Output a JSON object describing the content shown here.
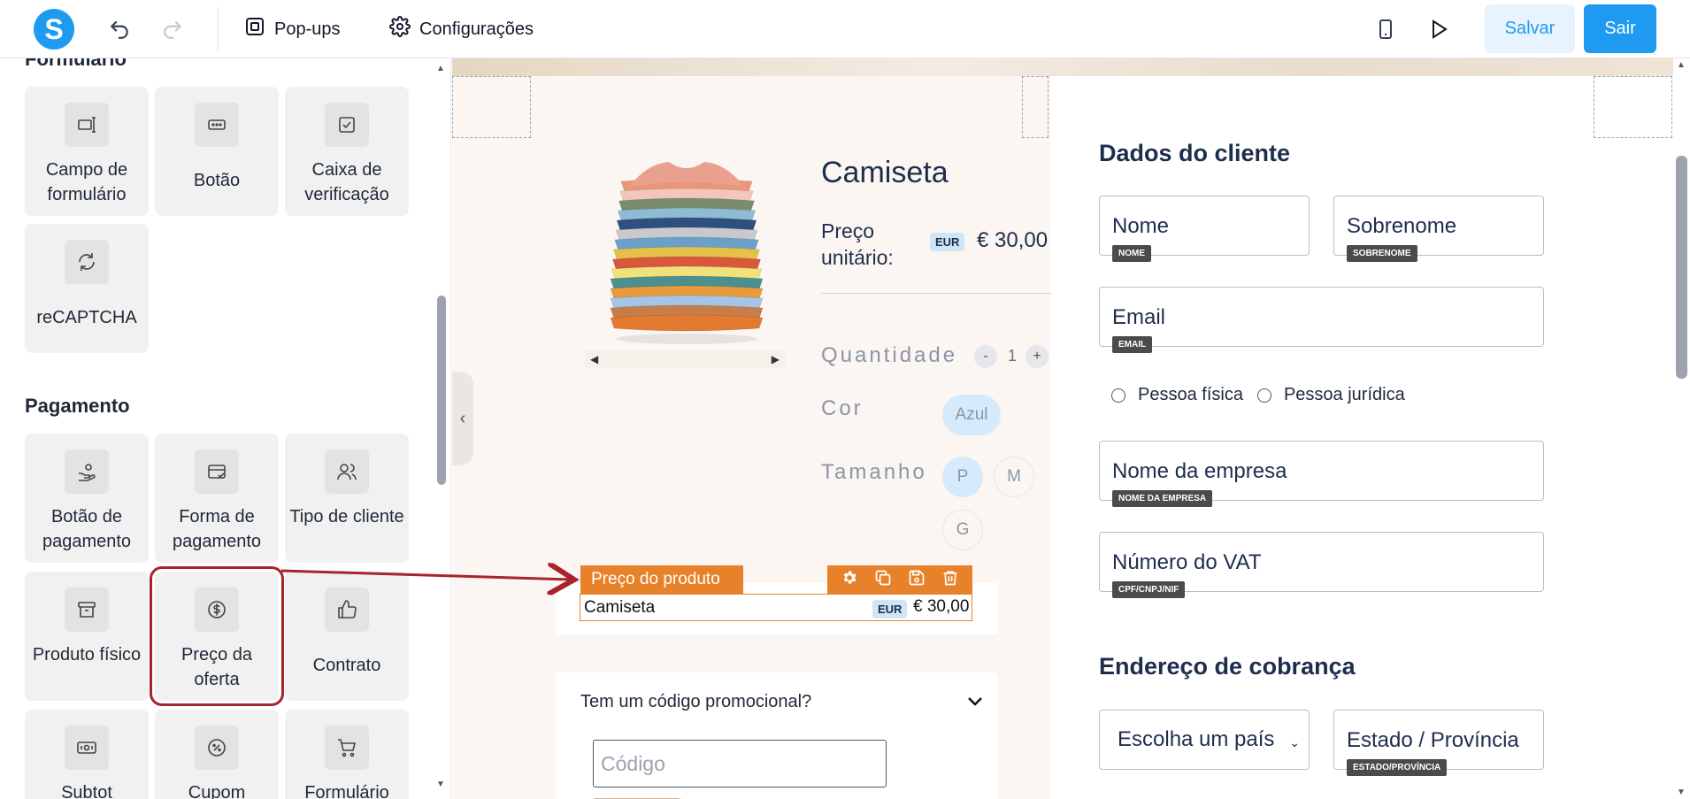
{
  "topbar": {
    "logo_letter": "S",
    "popups_label": "Pop-ups",
    "settings_label": "Configurações",
    "save_label": "Salvar",
    "exit_label": "Sair"
  },
  "sidebar": {
    "partial_section_title": "Formulário",
    "form_tiles": [
      {
        "label": "Campo de formulário",
        "icon": "form-field-icon"
      },
      {
        "label": "Botão",
        "icon": "button-icon"
      },
      {
        "label": "Caixa de verificação",
        "icon": "checkbox-icon"
      },
      {
        "label": "reCAPTCHA",
        "icon": "refresh-icon"
      }
    ],
    "payment_title": "Pagamento",
    "payment_tiles": [
      {
        "label": "Botão de pagamento",
        "icon": "payment-hand-icon"
      },
      {
        "label": "Forma de pagamento",
        "icon": "card-icon"
      },
      {
        "label": "Tipo de cliente",
        "icon": "users-icon"
      },
      {
        "label": "Produto físico",
        "icon": "box-icon"
      },
      {
        "label": "Preço da oferta",
        "icon": "dollar-icon"
      },
      {
        "label": "Contrato",
        "icon": "thumbs-up-icon"
      },
      {
        "label": "Subtot",
        "icon": "banknote-icon"
      },
      {
        "label": "Cupom",
        "icon": "percent-icon"
      },
      {
        "label": "Formulário",
        "icon": "cart-icon"
      }
    ]
  },
  "product": {
    "title": "Camiseta",
    "price_label": "Preço unitário:",
    "currency": "EUR",
    "price": "€ 30,00",
    "quantity_label": "Quantidade",
    "quantity": "1",
    "minus": "-",
    "plus": "+",
    "color_label": "Cor",
    "color_options": [
      "Azul"
    ],
    "size_label": "Tamanho",
    "size_options": [
      "P",
      "M",
      "G"
    ],
    "selected_size": "P"
  },
  "component": {
    "label": "Preço do produto",
    "item_name": "Camiseta",
    "currency": "EUR",
    "price": "€ 30,00"
  },
  "promo": {
    "question": "Tem um código promocional?",
    "input_placeholder": "Código"
  },
  "form": {
    "customer_heading": "Dados do cliente",
    "fields": {
      "first_name": {
        "label": "Nome",
        "tag": "NOME"
      },
      "last_name": {
        "label": "Sobrenome",
        "tag": "SOBRENOME"
      },
      "email": {
        "label": "Email",
        "tag": "EMAIL"
      },
      "company": {
        "label": "Nome da empresa",
        "tag": "NOME DA EMPRESA"
      },
      "vat": {
        "label": "Número do VAT",
        "tag": "CPF/CNPJ/NIF"
      },
      "state": {
        "label": "Estado / Província",
        "tag": "ESTADO/PROVÍNCIA"
      }
    },
    "radio_individual": "Pessoa física",
    "radio_company": "Pessoa jurídica",
    "billing_heading": "Endereço de cobrança",
    "country_select": "Escolha um país"
  },
  "colors": {
    "brand": "#1e9bf0",
    "component_orange": "#e8822a",
    "highlight_red": "#a8232b",
    "text_navy": "#1f2d4d"
  }
}
